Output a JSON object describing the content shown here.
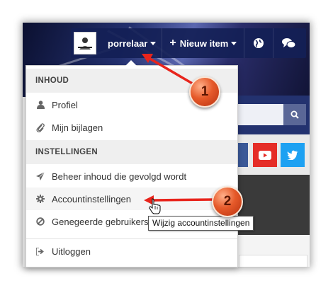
{
  "topbar": {
    "username": "porrelaar",
    "new_item": "Nieuw item",
    "globe_icon": "globe-icon",
    "chat_icon": "chat-icon"
  },
  "dropdown": {
    "section_content": "INHOUD",
    "items_content": [
      {
        "label": "Profiel",
        "icon": "user-icon"
      },
      {
        "label": "Mijn bijlagen",
        "icon": "paperclip-icon"
      }
    ],
    "section_settings": "INSTELLINGEN",
    "items_settings": [
      {
        "label": "Beheer inhoud die gevolgd wordt",
        "icon": "send-icon"
      },
      {
        "label": "Accountinstellingen",
        "icon": "gear-icon"
      },
      {
        "label": "Genegeerde gebruikers",
        "icon": "ban-icon"
      }
    ],
    "logout": {
      "label": "Uitloggen",
      "icon": "sign-out-icon"
    }
  },
  "tooltip": "Wijzig accountinstellingen",
  "callouts": [
    "1",
    "2"
  ],
  "colors": {
    "navbar": "#142056",
    "arrow": "#e8241c",
    "callout": "#e65a2a",
    "facebook": "#3b5998",
    "youtube": "#e52d27",
    "twitter": "#1da1f2"
  }
}
